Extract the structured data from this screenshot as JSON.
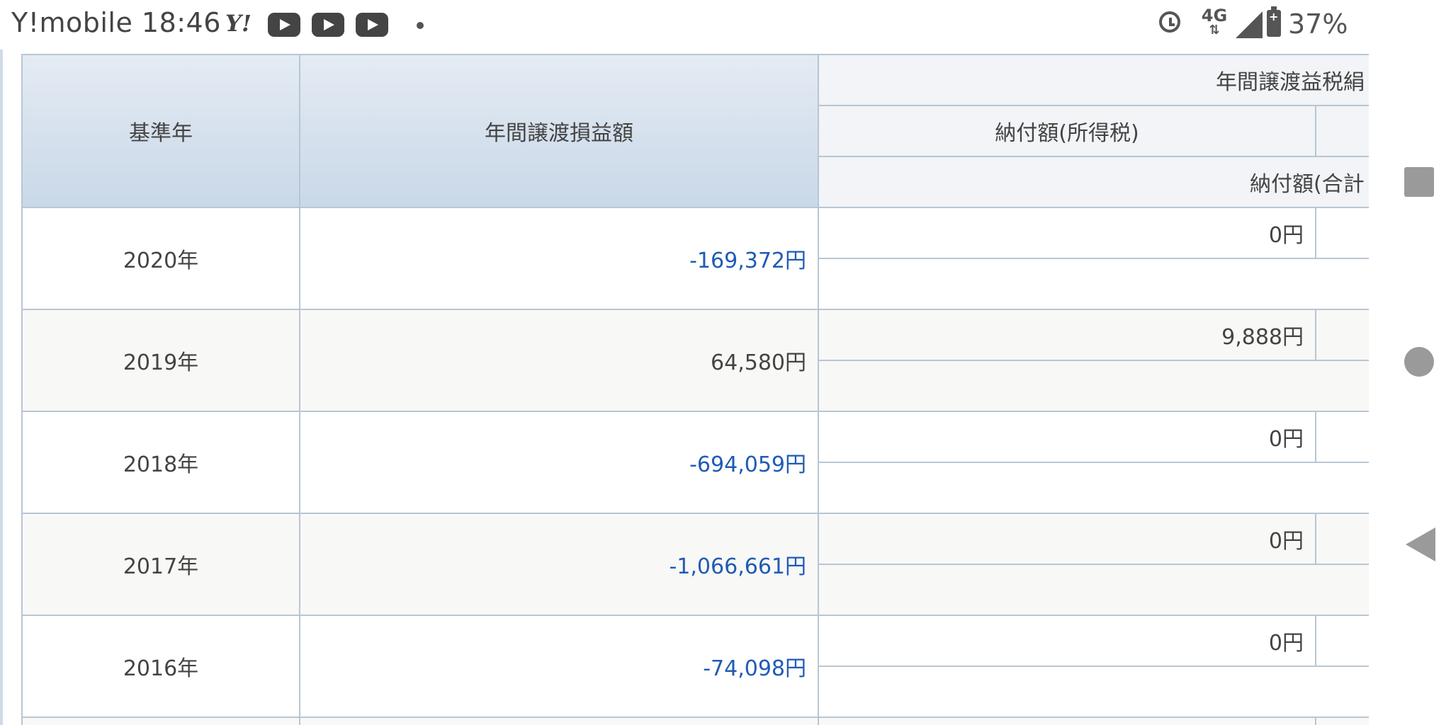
{
  "status_bar": {
    "carrier_time": "Y!mobile 18:46",
    "yahoo_icon_text": "Y!",
    "network": "4G",
    "battery": "37%",
    "icons": [
      "yahoo-icon",
      "youtube-icon",
      "youtube-icon",
      "youtube-icon",
      "notification-dot-icon",
      "alarm-icon",
      "4g-icon",
      "signal-icon",
      "battery-icon"
    ]
  },
  "table": {
    "headers": {
      "year": "基準年",
      "annual_gain_loss": "年間譲渡損益額",
      "tax_group": "年間譲渡益税絹",
      "payment_income_tax": "納付額(所得税)",
      "payment_total": "納付額(合計"
    },
    "rows": [
      {
        "year": "2020年",
        "amount": "-169,372円",
        "negative": true,
        "payment": "0円"
      },
      {
        "year": "2019年",
        "amount": "64,580円",
        "negative": false,
        "payment": "9,888円"
      },
      {
        "year": "2018年",
        "amount": "-694,059円",
        "negative": true,
        "payment": "0円"
      },
      {
        "year": "2017年",
        "amount": "-1,066,661円",
        "negative": true,
        "payment": "0円"
      },
      {
        "year": "2016年",
        "amount": "-74,098円",
        "negative": true,
        "payment": "0円"
      }
    ]
  },
  "nav_bar": {
    "icons": [
      "recents-square-icon",
      "home-circle-icon",
      "back-triangle-icon"
    ]
  }
}
